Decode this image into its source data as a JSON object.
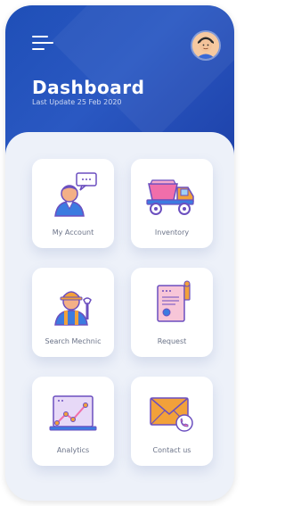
{
  "header": {
    "title": "Dashboard",
    "subtitle": "Last Update 25 Feb 2020",
    "bg_color": "#1f4fb7"
  },
  "menu": {
    "icon": "hamburger-menu-icon"
  },
  "user": {
    "avatar_icon": "user-avatar-icon"
  },
  "cards": [
    {
      "label": "My Account",
      "icon": "user-chat-icon"
    },
    {
      "label": "Inventory",
      "icon": "dump-truck-icon"
    },
    {
      "label": "Search Mechnic",
      "icon": "mechanic-icon"
    },
    {
      "label": "Request",
      "icon": "request-document-icon"
    },
    {
      "label": "Analytics",
      "icon": "analytics-chart-icon"
    },
    {
      "label": "Contact us",
      "icon": "mail-phone-icon"
    }
  ],
  "colors": {
    "panel": "#edf1f9",
    "card": "#ffffff",
    "accent_orange": "#f2a13a",
    "accent_purple": "#6b4fbf",
    "accent_blue": "#3c7be0"
  }
}
